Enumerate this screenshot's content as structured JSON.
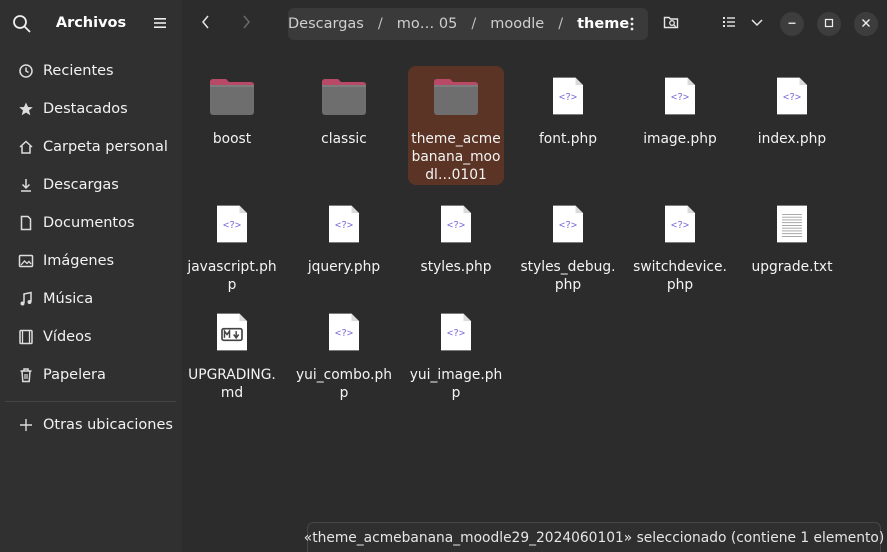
{
  "sidebar": {
    "title": "Archivos",
    "places": [
      {
        "label": "Recientes",
        "icon": "clock-icon"
      },
      {
        "label": "Destacados",
        "icon": "star-icon"
      },
      {
        "label": "Carpeta personal",
        "icon": "home-icon"
      },
      {
        "label": "Descargas",
        "icon": "download-icon"
      },
      {
        "label": "Documentos",
        "icon": "document-icon"
      },
      {
        "label": "Imágenes",
        "icon": "image-icon"
      },
      {
        "label": "Música",
        "icon": "music-icon"
      },
      {
        "label": "Vídeos",
        "icon": "video-icon"
      },
      {
        "label": "Papelera",
        "icon": "trash-icon"
      }
    ],
    "other_locations": "Otras ubicaciones"
  },
  "pathbar": {
    "crumbs": [
      "Descargas",
      "mo… 05",
      "moodle"
    ],
    "current": "theme"
  },
  "files": [
    {
      "name": "boost",
      "type": "folder"
    },
    {
      "name": "classic",
      "type": "folder"
    },
    {
      "name": "theme_acmebanana_moodl…0101",
      "type": "folder",
      "selected": true
    },
    {
      "name": "font.php",
      "type": "php"
    },
    {
      "name": "image.php",
      "type": "php"
    },
    {
      "name": "index.php",
      "type": "php"
    },
    {
      "name": "javascript.php",
      "type": "php"
    },
    {
      "name": "jquery.php",
      "type": "php"
    },
    {
      "name": "styles.php",
      "type": "php"
    },
    {
      "name": "styles_debug.php",
      "type": "php"
    },
    {
      "name": "switchdevice.php",
      "type": "php"
    },
    {
      "name": "upgrade.txt",
      "type": "txt"
    },
    {
      "name": "UPGRADING.md",
      "type": "md"
    },
    {
      "name": "yui_combo.php",
      "type": "php"
    },
    {
      "name": "yui_image.php",
      "type": "php"
    }
  ],
  "status": "«theme_acmebanana_moodle29_2024060101» seleccionado  (contiene 1 elemento)",
  "colors": {
    "selection": "#5b3426",
    "folder_tab": "#b84a68",
    "php_glyph": "#7a6cd6"
  }
}
